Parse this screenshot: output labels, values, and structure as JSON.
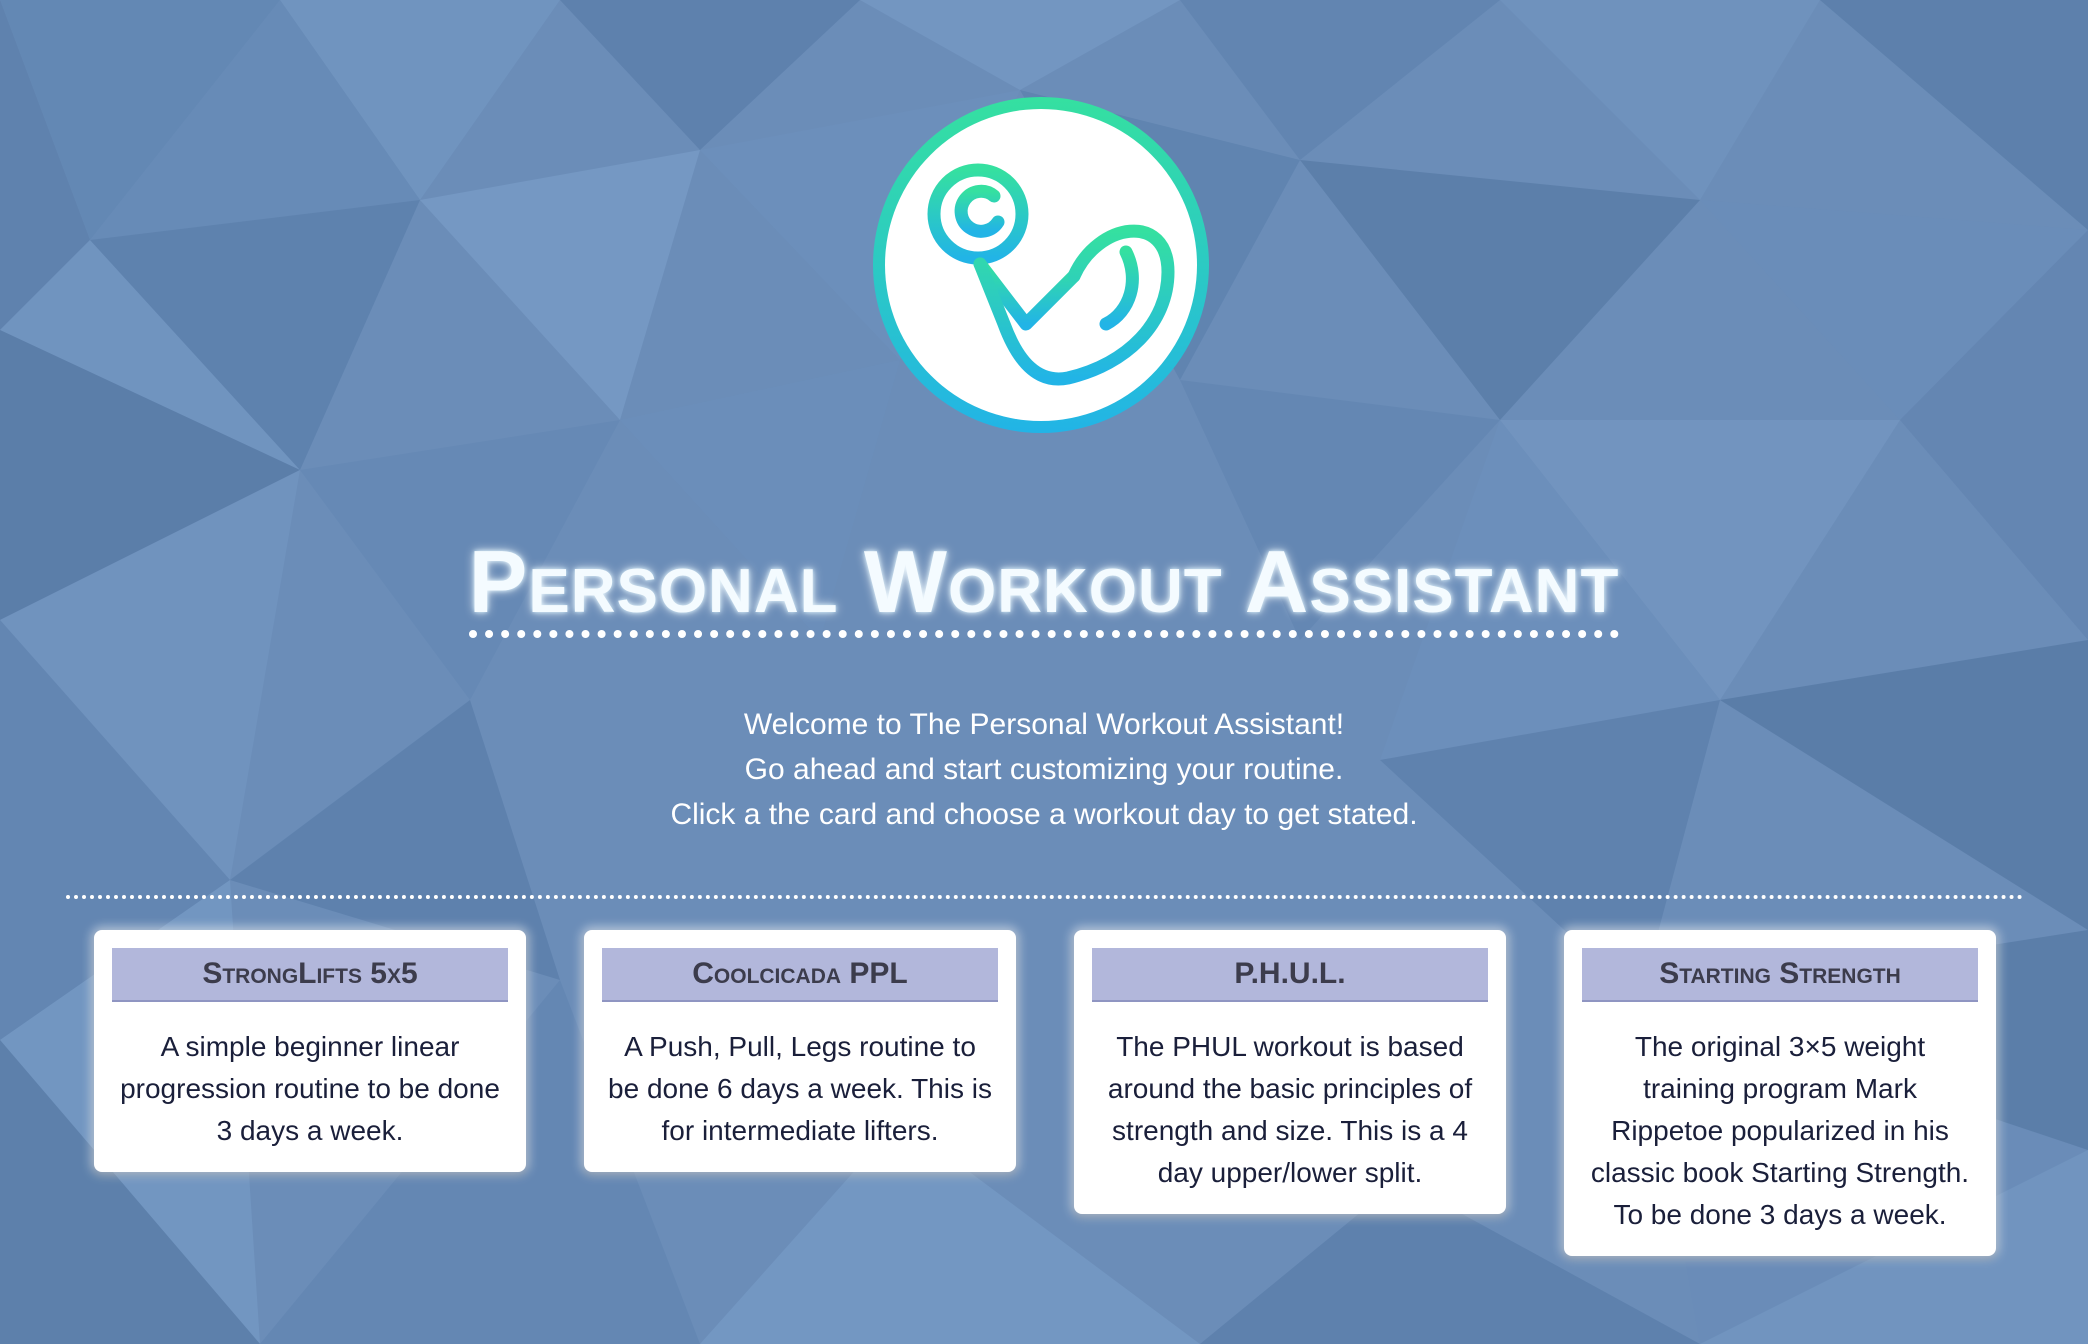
{
  "app": {
    "title": "Personal Workout Assistant"
  },
  "logo": {
    "icon": "flexed-arm-dumbbell-icon",
    "gradient_top": "#35e0a0",
    "gradient_bottom": "#22b4e6"
  },
  "welcome": {
    "line1": "Welcome to The Personal Workout Assistant!",
    "line2": "Go ahead and start customizing your routine.",
    "line3": "Click a the card and choose a workout day to get stated."
  },
  "colors": {
    "background": "#6b8db8",
    "card_header": "#b2b7db",
    "card_text": "#1a1f3a"
  },
  "cards": [
    {
      "title": "StrongLifts 5x5",
      "lines": [
        "A simple beginner linear",
        "progression routine to be done",
        "3 days a week."
      ]
    },
    {
      "title": "Coolcicada PPL",
      "lines": [
        "A Push, Pull, Legs routine to",
        "be done 6 days a week. This is",
        "for intermediate lifters."
      ]
    },
    {
      "title": "P.H.U.L.",
      "lines": [
        "The PHUL workout is based",
        "around the basic principles of",
        "strength and size. This is a 4",
        "day upper/lower split."
      ]
    },
    {
      "title": "Starting Strength",
      "lines": [
        "The original 3×5 weight",
        "training program Mark",
        "Rippetoe popularized in his",
        "classic book Starting Strength.",
        "To be done 3 days a week."
      ]
    }
  ]
}
